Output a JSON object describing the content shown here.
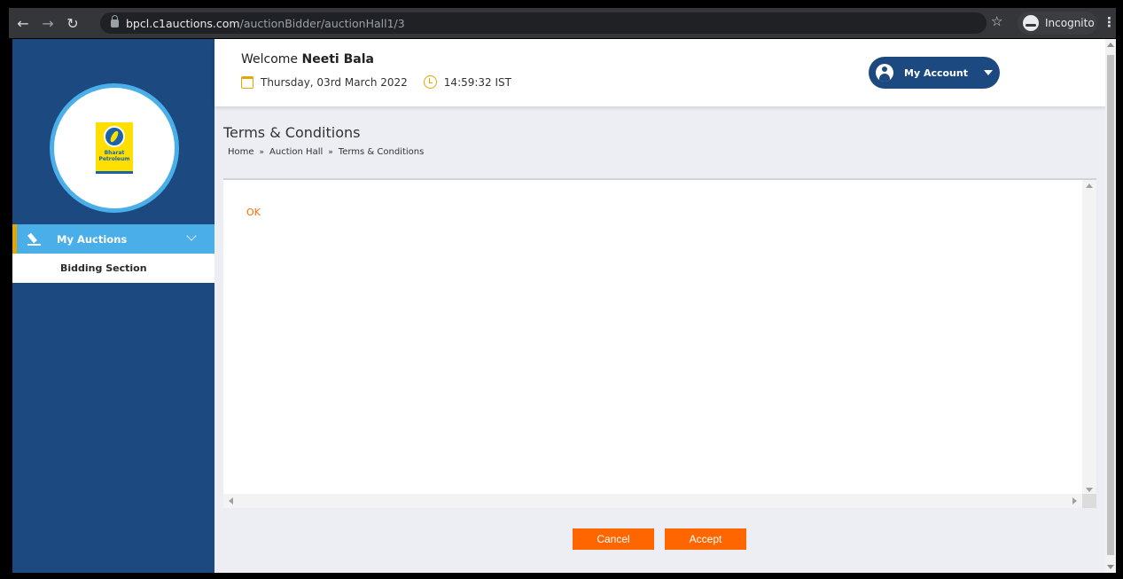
{
  "browser": {
    "url_host": "bpcl.c1auctions.com",
    "url_path": "/auctionBidder/auctionHall1/3",
    "incognito_label": "Incognito"
  },
  "sidebar": {
    "logo_text_line1": "Bharat",
    "logo_text_line2": "Petroleum",
    "menu": {
      "active_label": "My Auctions",
      "sub_items": [
        "Bidding Section"
      ]
    }
  },
  "header": {
    "welcome_prefix": "Welcome",
    "user_name": "Neeti Bala",
    "date": "Thursday, 03rd March 2022",
    "time": "14:59:32 IST",
    "account_label": "My Account"
  },
  "main": {
    "title": "Terms & Conditions",
    "breadcrumb": [
      "Home",
      "Auction Hall",
      "Terms & Conditions"
    ],
    "breadcrumb_separator": "»",
    "terms_content": "OK",
    "buttons": {
      "cancel": "Cancel",
      "accept": "Accept"
    }
  },
  "colors": {
    "sidebar_bg": "#1c4a80",
    "accent_blue": "#4aaee9",
    "accent_orange": "#ff6600",
    "active_border": "#e0a800"
  }
}
